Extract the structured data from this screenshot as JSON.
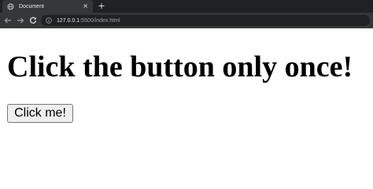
{
  "browser": {
    "tab": {
      "title": "Document",
      "close_glyph": "×",
      "icon": "globe-icon"
    },
    "new_tab_glyph": "+",
    "address": {
      "host": "127.0.0.1",
      "rest": ":5500/index.html"
    },
    "nav_icons": [
      "arrow-left-icon",
      "arrow-right-icon",
      "reload-icon"
    ]
  },
  "page": {
    "heading": "Click the button only once!",
    "button_label": "Click me!"
  },
  "colors": {
    "tabstrip": "#202124",
    "toolbar": "#35363a",
    "page_background": "#ffffff",
    "button_background": "#efefef"
  }
}
